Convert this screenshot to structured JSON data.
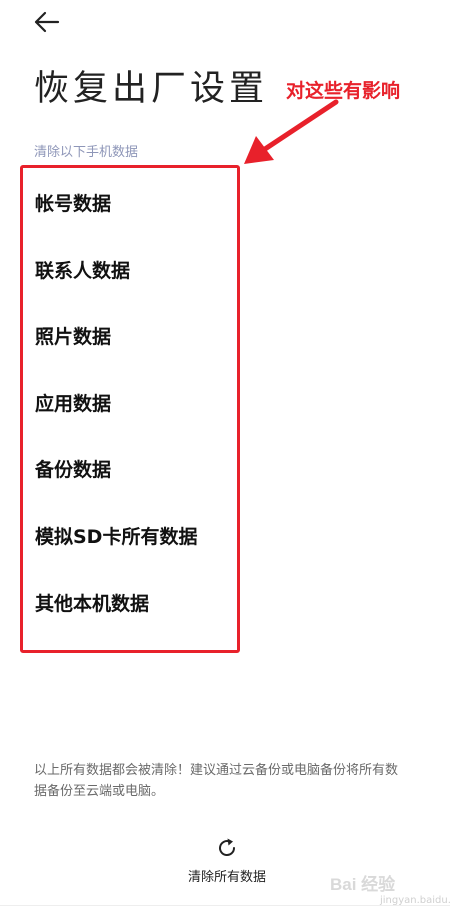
{
  "header": {
    "back_icon": "arrow-left-icon",
    "title": "恢复出厂设置"
  },
  "annotation": {
    "text": "对这些有影响",
    "color": "#e8212b"
  },
  "section": {
    "caption": "清除以下手机数据",
    "items": [
      "帐号数据",
      "联系人数据",
      "照片数据",
      "应用数据",
      "备份数据",
      "模拟SD卡所有数据",
      "其他本机数据"
    ]
  },
  "footer": {
    "note": "以上所有数据都会被清除！建议通过云备份或电脑备份将所有数据备份至云端或电脑。",
    "reset_icon": "refresh-icon",
    "reset_label": "清除所有数据"
  },
  "watermark": {
    "text": "Bai 经验",
    "sub": "jingyan.baidu.com"
  }
}
